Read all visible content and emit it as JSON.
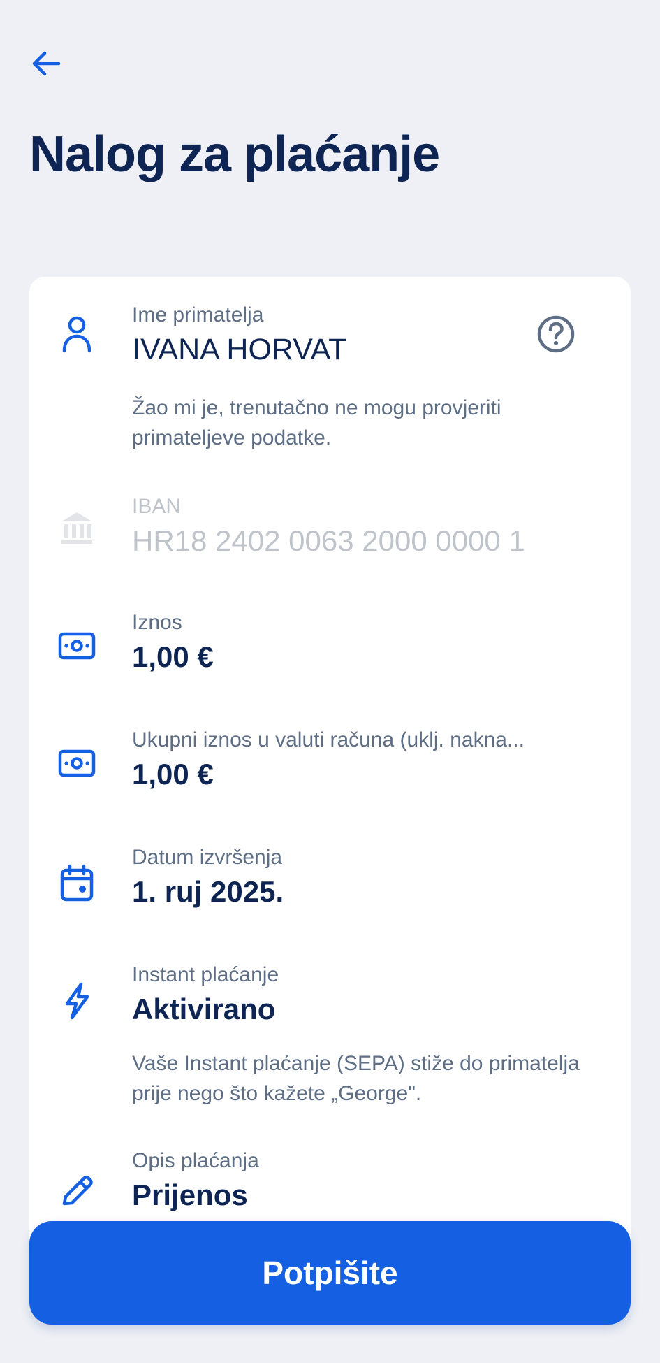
{
  "header": {
    "title": "Nalog za plaćanje"
  },
  "recipient": {
    "label": "Ime primatelja",
    "value": "IVANA HORVAT",
    "note": "Žao mi je, trenutačno ne mogu provjeriti primateljeve podatke."
  },
  "iban": {
    "label": "IBAN",
    "value": "HR18 2402 0063 2000 0000 1"
  },
  "amount": {
    "label": "Iznos",
    "value": "1,00 €"
  },
  "total": {
    "label": "Ukupni iznos u valuti računa (uklj. nakna...",
    "value": "1,00 €"
  },
  "date": {
    "label": "Datum izvršenja",
    "value": "1. ruj 2025."
  },
  "instant": {
    "label": "Instant plaćanje",
    "value": "Aktivirano",
    "note": "Vaše Instant plaćanje (SEPA) stiže do primatelja prije nego što kažete „George\"."
  },
  "description": {
    "label": "Opis plaćanja",
    "value": "Prijenos"
  },
  "actions": {
    "sign_label": "Potpišite"
  },
  "colors": {
    "primary": "#1560E2",
    "navy": "#0E2452",
    "muted": "#5E6E85",
    "disabled": "#BFC3CA",
    "background": "#EEF0F5"
  },
  "icons": {
    "back": "arrow-left-icon",
    "recipient": "person-icon",
    "help": "question-circle-icon",
    "iban": "bank-icon",
    "amount": "banknote-icon",
    "total": "banknote-icon",
    "date": "calendar-icon",
    "instant": "lightning-icon",
    "description": "pencil-icon"
  }
}
